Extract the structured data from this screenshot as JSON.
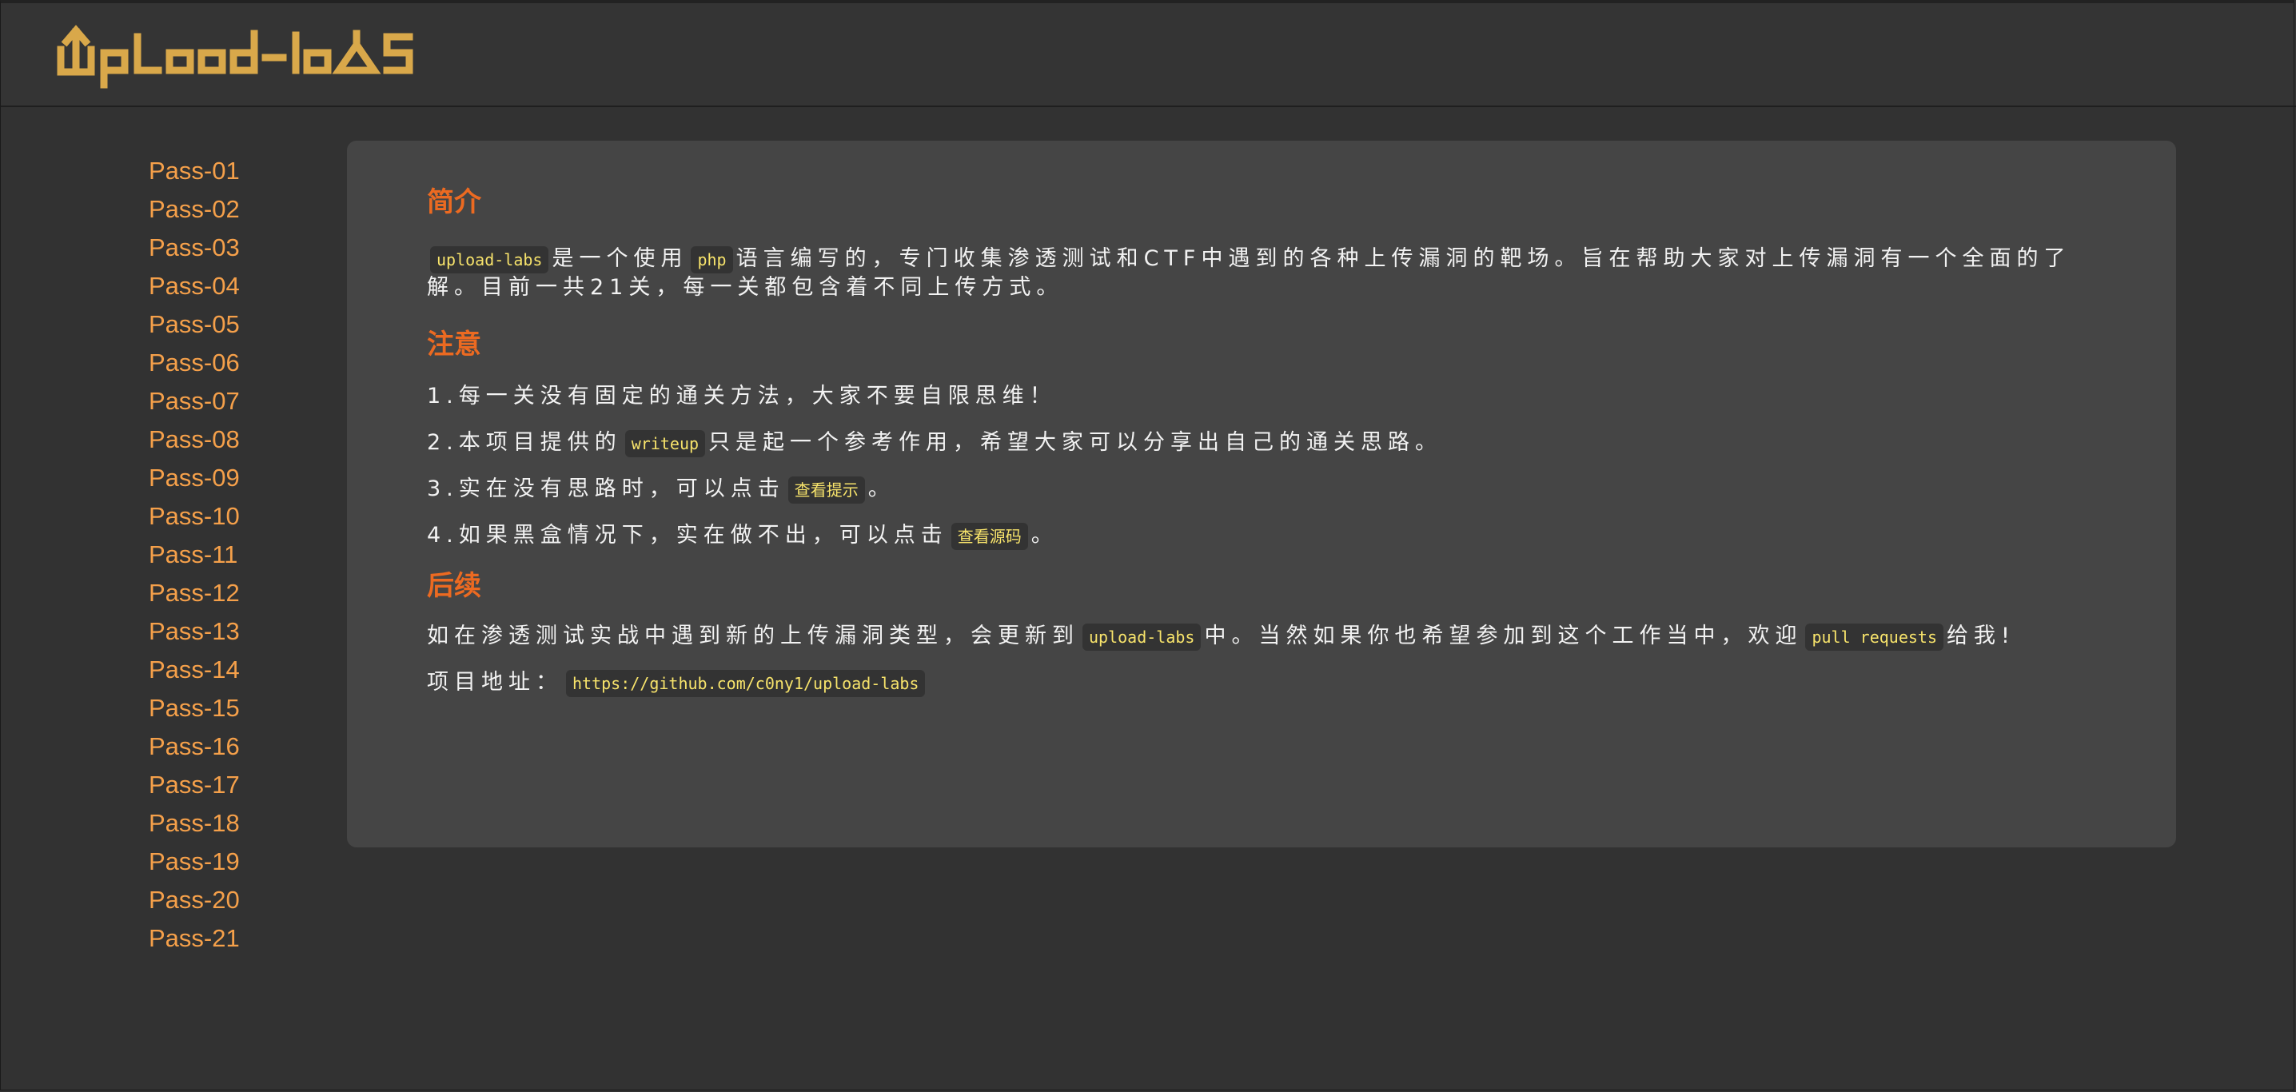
{
  "header": {
    "logo_text": "Upload-labs"
  },
  "sidebar": {
    "items": [
      {
        "label": "Pass-01"
      },
      {
        "label": "Pass-02"
      },
      {
        "label": "Pass-03"
      },
      {
        "label": "Pass-04"
      },
      {
        "label": "Pass-05"
      },
      {
        "label": "Pass-06"
      },
      {
        "label": "Pass-07"
      },
      {
        "label": "Pass-08"
      },
      {
        "label": "Pass-09"
      },
      {
        "label": "Pass-10"
      },
      {
        "label": "Pass-11"
      },
      {
        "label": "Pass-12"
      },
      {
        "label": "Pass-13"
      },
      {
        "label": "Pass-14"
      },
      {
        "label": "Pass-15"
      },
      {
        "label": "Pass-16"
      },
      {
        "label": "Pass-17"
      },
      {
        "label": "Pass-18"
      },
      {
        "label": "Pass-19"
      },
      {
        "label": "Pass-20"
      },
      {
        "label": "Pass-21"
      }
    ]
  },
  "content": {
    "intro": {
      "title": "简介",
      "code1": "upload-labs",
      "text1": "是一个使用",
      "code2": "php",
      "text2": "语言编写的，专门收集渗透测试和CTF中遇到的各种上传漏洞的靶场。旨在帮助大家对上传漏洞有一个全面的了解。目前一共21关，每一关都包含着不同上传方式。"
    },
    "notes": {
      "title": "注意",
      "item1": "1.每一关没有固定的通关方法，大家不要自限思维！",
      "item2_pre": "2.本项目提供的",
      "item2_code": "writeup",
      "item2_post": "只是起一个参考作用，希望大家可以分享出自己的通关思路。",
      "item3_pre": "3.实在没有思路时，可以点击",
      "item3_button": "查看提示",
      "item3_post": "。",
      "item4_pre": "4.如果黑盒情况下，实在做不出，可以点击",
      "item4_button": "查看源码",
      "item4_post": "。"
    },
    "follow": {
      "title": "后续",
      "text1": "如在渗透测试实战中遇到新的上传漏洞类型，会更新到",
      "code1": "upload-labs",
      "text2": "中。当然如果你也希望参加到这个工作当中，欢迎",
      "code2": "pull requests",
      "text3": "给我!",
      "addr_label": "项目地址：",
      "addr_url": "https://github.com/c0ny1/upload-labs"
    }
  },
  "colors": {
    "background": "#323232",
    "panel": "#454545",
    "accent_title": "#ec6a21",
    "sidebar_link": "#f5a04a",
    "logo": "#d9a84a",
    "code_text": "#f7e36b"
  }
}
